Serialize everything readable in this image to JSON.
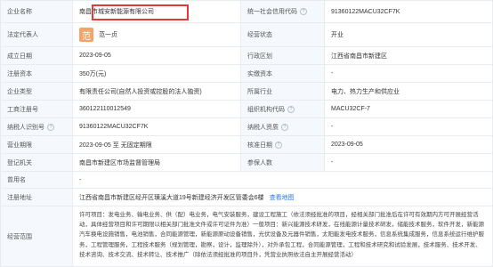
{
  "rows": [
    {
      "l1": "企业名称",
      "v1": "南昌市城安新能源有限公司",
      "l2": "统一社会信用代码",
      "v2": "91360122MACU32CF7K"
    },
    {
      "l1": "法定代表人",
      "avatar": "范",
      "v1": "范一贞",
      "l2": "经营状态",
      "v2": "开业"
    },
    {
      "l1": "成立日期",
      "v1": "2023-09-05",
      "l2": "行政区划",
      "v2": "江西省南昌市新建区"
    },
    {
      "l1": "注册资本",
      "v1": "350万(元)",
      "l2": "实缴资本",
      "v2": "-"
    },
    {
      "l1": "企业类型",
      "v1": "有限责任公司(自然人投资或控股的法人独资)",
      "l2": "所属行业",
      "v2": "电力、热力生产和供应业"
    },
    {
      "l1": "工商注册号",
      "v1": "360122110012549",
      "l2": "组织机构代码",
      "v2": "MACU32CF-7"
    },
    {
      "l1": "纳税人识别号",
      "v1": "91360122MACU32CF7K",
      "l2": "纳税人资质",
      "v2": "-"
    },
    {
      "l1": "营业期限",
      "v1": "2023-09-05 至 无固定期限",
      "l2": "核准日期",
      "v2": "2023-09-05"
    },
    {
      "l1": "登记机关",
      "v1": "南昌市新建区市场监督管理局",
      "l2": "参保人数",
      "v2": "-"
    }
  ],
  "former_name": {
    "label": "曾用名",
    "value": "-"
  },
  "address": {
    "label": "注册地址",
    "value": "江西省南昌市新建区经开区璜溪大道19号新建经济开发区管委会6楼",
    "link": "查看地图"
  },
  "scope": {
    "label": "经营范围",
    "value": "许可项目：发电业务、输电业务、供（配）电业务，电气安装服务，建设工程施工（依法须经批准的项目，经相关部门批准后在许可有效期内方可开展经营活动，具体经营项目和许可期限以相关部门批准文件或许可证件为准）一般项目：新兴能源技术研发，在线能源计量技术研发，储能技术服务，软件开发，新能源汽车换电设施销售，电池销售，合同能源管理，新能源原动设备销售，光伏设备及元器件销售，太阳能发电技术服务，信息系统集成服务，信息系统运行维护服务，工程管理服务，工程技术服务（规划管理，勘察，设计，监理除外），对外承包工程，合同能源管理，工程和技术研究和试验发展，技术服务、技术开发、技术咨询、技术交流、技术转让、技术推广（除依法须经批准的项目外，凭营业执照依法自主开展经营活动）"
  }
}
